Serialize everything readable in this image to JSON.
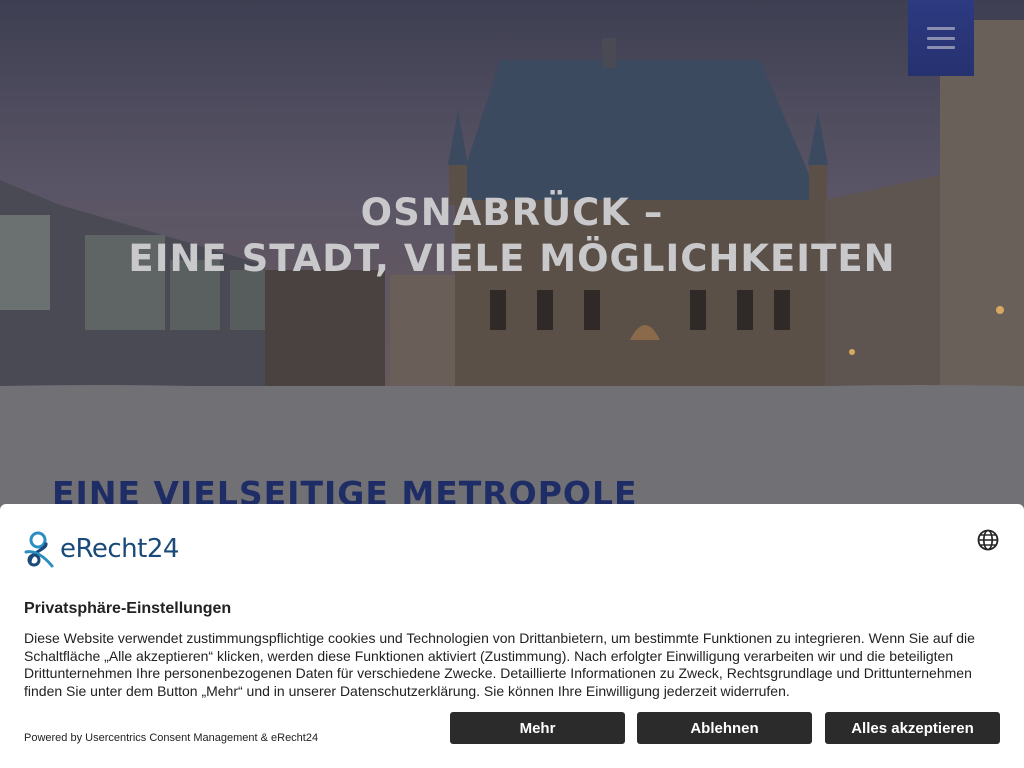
{
  "hero": {
    "title_line1": "OSNABRÜCK –",
    "title_line2": "EINE STADT, VIELE MÖGLICHKEITEN"
  },
  "section": {
    "heading": "EINE VIELSEITIGE METROPOLE"
  },
  "consent": {
    "logo_text": "eRecht24",
    "title": "Privatsphäre-Einstellungen",
    "body": "Diese Website verwendet zustimmungspflichtige cookies und Technologien von Drittanbietern, um bestimmte Funktionen zu integrieren. Wenn Sie auf die Schaltfläche „Alle akzeptieren“ klicken, werden diese Funktionen aktiviert (Zustimmung). Nach erfolgter Einwilligung verarbeiten wir und die beteiligten Drittunternehmen Ihre personenbezogenen Daten für verschiedene Zwecke. Detaillierte Informationen zu Zweck, Rechtsgrundlage und Drittunternehmen finden Sie unter dem Button „Mehr“ und in unserer Datenschutzerklärung. Sie können Ihre Einwilligung jederzeit widerrufen.",
    "powered_by": "Powered by Usercentrics Consent Management & eRecht24",
    "buttons": {
      "more": "Mehr",
      "decline": "Ablehnen",
      "accept_all": "Alles akzeptieren"
    }
  },
  "icons": {
    "menu": "hamburger-menu-icon",
    "language": "globe-icon",
    "logo": "erecht24-logo-icon"
  },
  "colors": {
    "menu_bg": "#2d3a80",
    "heading": "#1f2d66",
    "button_bg": "#2b2b2b",
    "logo_blue": "#1a4a7a"
  }
}
